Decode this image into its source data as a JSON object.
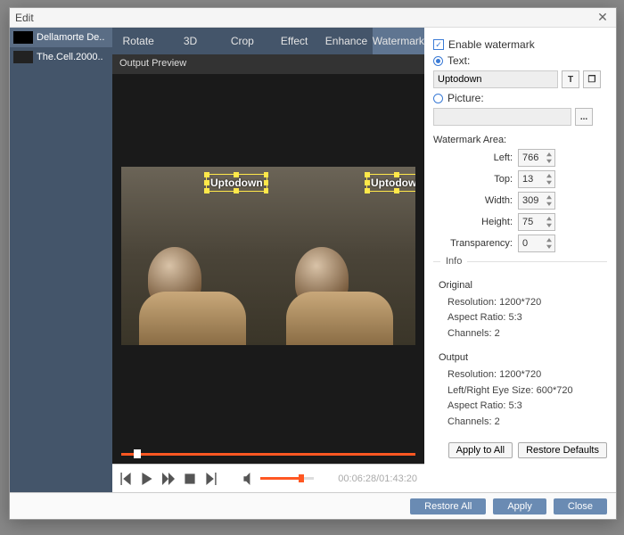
{
  "window": {
    "title": "Edit"
  },
  "files": [
    {
      "name": "Dellamorte De..",
      "selected": true
    },
    {
      "name": "The.Cell.2000..",
      "selected": false
    }
  ],
  "tabs": {
    "rotate": "Rotate",
    "three_d": "3D",
    "crop": "Crop",
    "effect": "Effect",
    "enhance": "Enhance",
    "watermark": "Watermark"
  },
  "preview": {
    "label": "Output Preview",
    "watermark_text": "Uptodown",
    "time": "00:06:28/01:43:20"
  },
  "panel": {
    "enable_label": "Enable watermark",
    "text_label": "Text:",
    "text_value": "Uptodown",
    "picture_label": "Picture:",
    "browse_btn": "...",
    "area_label": "Watermark Area:",
    "left_label": "Left:",
    "left_val": "766",
    "top_label": "Top:",
    "top_val": "13",
    "width_label": "Width:",
    "width_val": "309",
    "height_label": "Height:",
    "height_val": "75",
    "transp_label": "Transparency:",
    "transp_val": "0",
    "info_label": "Info",
    "orig_head": "Original",
    "orig_res": "Resolution: 1200*720",
    "orig_ar": "Aspect Ratio: 5:3",
    "orig_ch": "Channels: 2",
    "out_head": "Output",
    "out_res": "Resolution: 1200*720",
    "out_eye": "Left/Right Eye Size: 600*720",
    "out_ar": "Aspect Ratio: 5:3",
    "out_ch": "Channels: 2",
    "apply_all": "Apply to All",
    "restore_def": "Restore Defaults"
  },
  "footer": {
    "restore_all": "Restore All",
    "apply": "Apply",
    "close": "Close"
  }
}
